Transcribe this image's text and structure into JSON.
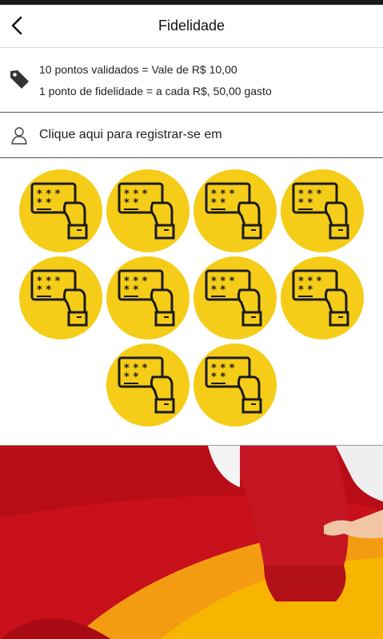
{
  "header": {
    "title": "Fidelidade",
    "back_icon": "chevron-left-icon"
  },
  "info": {
    "icon": "tag-icon",
    "line1": "10 pontos validados = Vale de R$ 10,00",
    "line2": "1 ponto de fidelidade = a cada R$, 50,00 gasto"
  },
  "register": {
    "icon": "user-icon",
    "label": "Clique aqui para registrar-se em"
  },
  "stamps": {
    "count": 10,
    "icon": "loyalty-card-icon",
    "color": "#f5cd18"
  },
  "banner": {
    "colors": {
      "red": "#c8101a",
      "orange": "#f39c12",
      "yellow": "#f7b500",
      "apron": "#c41622"
    }
  }
}
